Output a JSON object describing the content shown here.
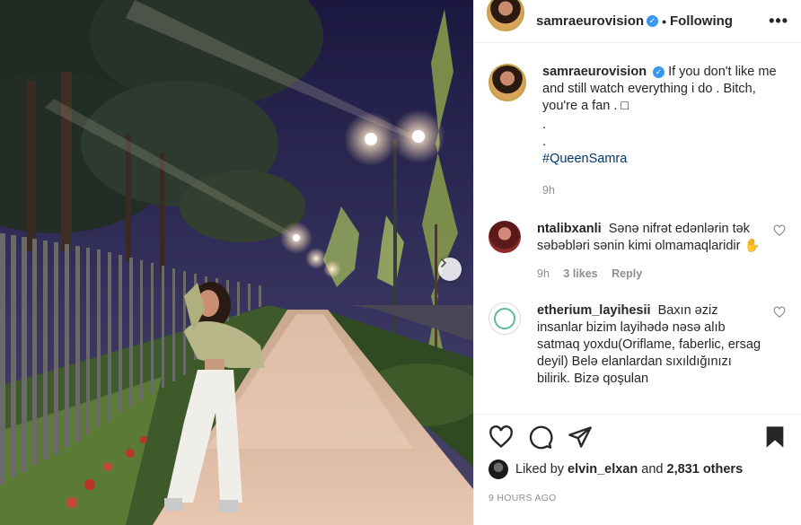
{
  "post": {
    "username": "samraeurovision",
    "following_label": "Following",
    "more_label": "•••",
    "verified_glyph": "✓"
  },
  "caption": {
    "username": "samraeurovision",
    "text": "If you don't like me and still watch everything i do . Bitch, you're a fan . □",
    "dot1": ".",
    "dot2": ".",
    "hashtag": "#QueenSamra",
    "age": "9h"
  },
  "comments": [
    {
      "username": "ntalibxanli",
      "text": "Sənə nifrət edənlərin tək səbəbləri sənin kimi olmamaqlaridir ✋",
      "age": "9h",
      "likes": "3 likes",
      "reply": "Reply"
    },
    {
      "username": "etherium_layihesii",
      "text": "Baxın əziz insanlar bizim layihədə nəsə alıb satmaq yoxdu(Oriflame, faberlic, ersag deyil) Belə elanlardan sıxıldığınızı bilirik. Bizə qoşulan"
    }
  ],
  "actions": {
    "icons": [
      "heart-icon",
      "comment-icon",
      "share-icon",
      "bookmark-icon"
    ],
    "liked_by_prefix": "Liked by",
    "liked_by_user": "elvin_elxan",
    "and_word": "and",
    "others_count": "2,831 others",
    "timestamp": "9 HOURS AGO"
  },
  "colors": {
    "link": "#00376b",
    "verified": "#3897f0",
    "muted": "#8e8e8e"
  }
}
